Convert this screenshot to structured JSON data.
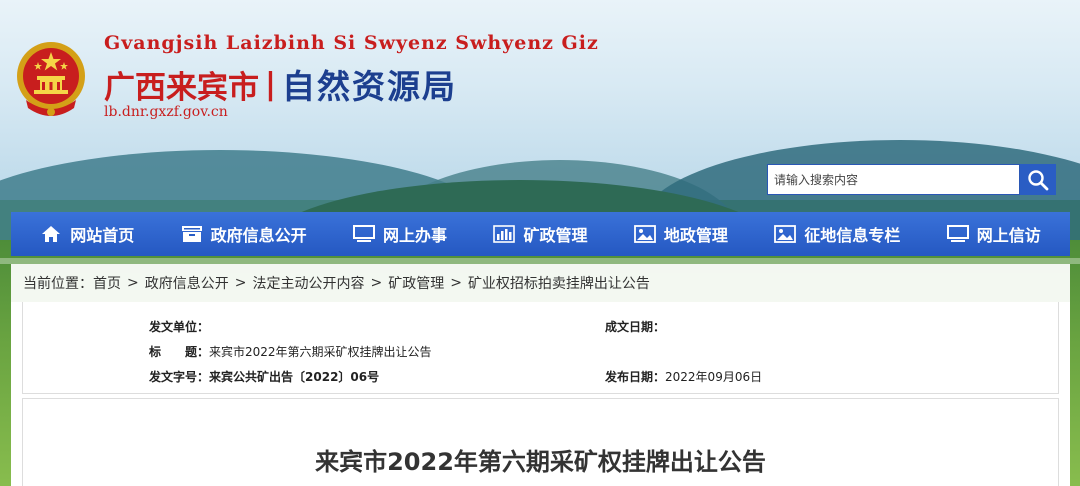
{
  "header": {
    "latin_name": "Gvangjsih Laizbinh Si Swyenz Swhyenz Giz",
    "city_name": "广西来宾市",
    "separator": "|",
    "department_name": "自然资源局",
    "url": "lb.dnr.gxzf.gov.cn"
  },
  "search": {
    "placeholder": "请输入搜索内容"
  },
  "nav": {
    "items": [
      {
        "label": "网站首页",
        "icon": "home-icon"
      },
      {
        "label": "政府信息公开",
        "icon": "archive-icon"
      },
      {
        "label": "网上办事",
        "icon": "monitor-icon"
      },
      {
        "label": "矿政管理",
        "icon": "bar-chart-icon"
      },
      {
        "label": "地政管理",
        "icon": "image-icon"
      },
      {
        "label": "征地信息专栏",
        "icon": "image-icon"
      },
      {
        "label": "网上信访",
        "icon": "monitor-icon"
      }
    ]
  },
  "breadcrumb": {
    "prefix": "当前位置：",
    "items": [
      "首页",
      "政府信息公开",
      "法定主动公开内容",
      "矿政管理",
      "矿业权招标拍卖挂牌出让公告"
    ],
    "arrow": ">"
  },
  "meta": {
    "issuer_label": "发文单位：",
    "issuer_value": "",
    "date_written_label": "成文日期：",
    "date_written_value": "",
    "subject_label": "标　　题：",
    "subject_value": "来宾市2022年第六期采矿权挂牌出让公告",
    "doc_no_label": "发文字号：",
    "doc_no_value": "来宾公共矿出告〔2022〕06号",
    "publish_label": "发布日期：",
    "publish_value": "2022年09月06日"
  },
  "document": {
    "title": "来宾市2022年第六期采矿权挂牌出让公告"
  },
  "colors": {
    "brand_red": "#c81e1e",
    "brand_blue": "#1c3f8f",
    "nav_blue": "#2a5dc4"
  }
}
